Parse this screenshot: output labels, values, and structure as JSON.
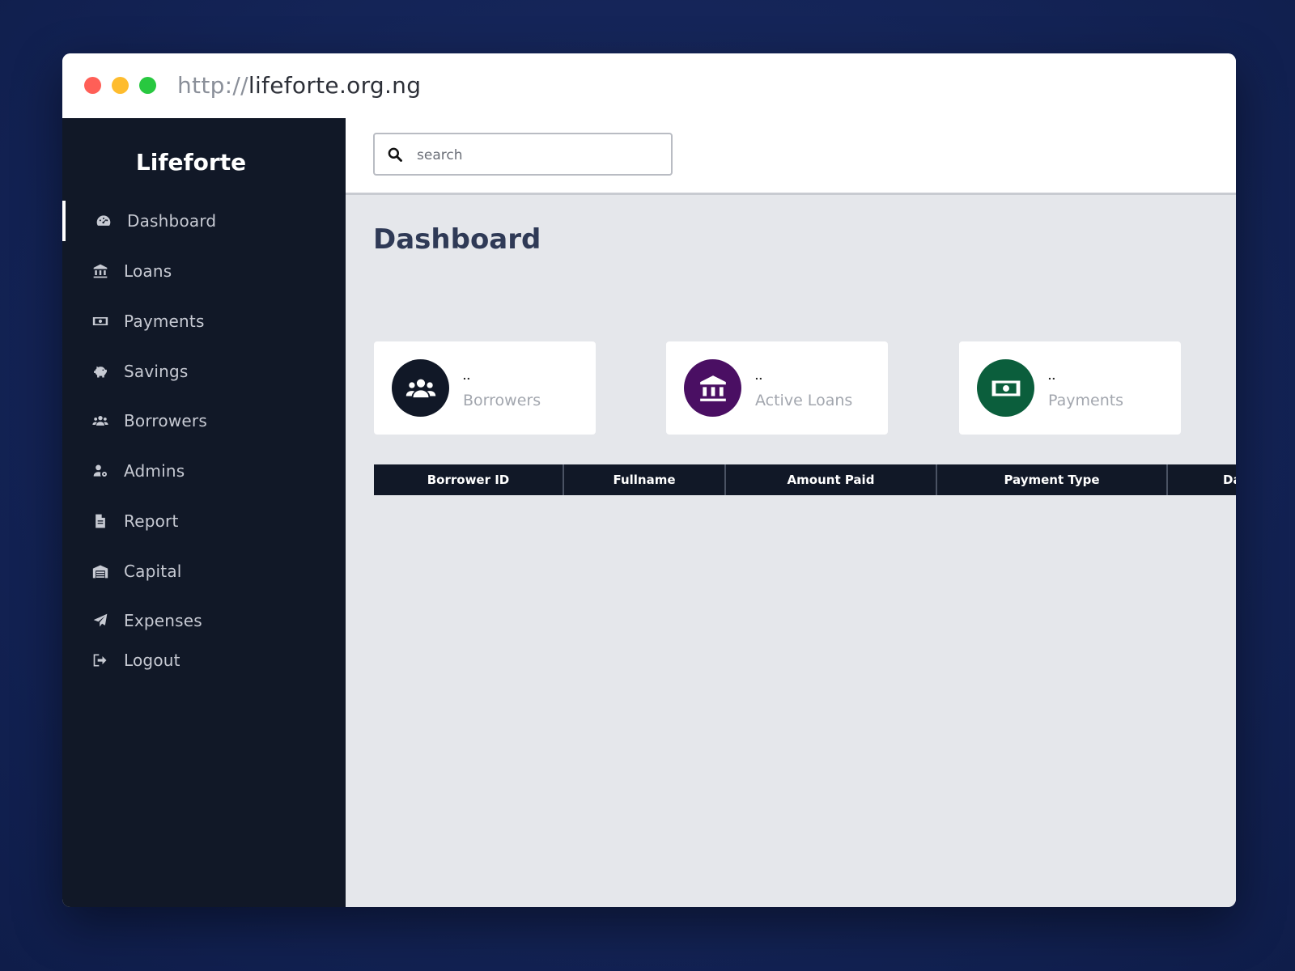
{
  "browser": {
    "url_protocol": "http://",
    "url_host": "lifeforte.org.ng"
  },
  "sidebar": {
    "brand": "Lifeforte",
    "items": [
      {
        "label": "Dashboard",
        "icon": "dashboard-gauge-icon",
        "active": true
      },
      {
        "label": "Loans",
        "icon": "bank-icon"
      },
      {
        "label": "Payments",
        "icon": "money-bill-icon"
      },
      {
        "label": "Savings",
        "icon": "piggy-bank-icon"
      },
      {
        "label": "Borrowers",
        "icon": "users-icon"
      },
      {
        "label": "Admins",
        "icon": "user-cog-icon"
      },
      {
        "label": "Report",
        "icon": "file-icon"
      },
      {
        "label": "Capital",
        "icon": "warehouse-icon"
      },
      {
        "label": "Expenses",
        "icon": "paper-plane-icon"
      },
      {
        "label": "Logout",
        "icon": "sign-out-icon"
      }
    ]
  },
  "search": {
    "placeholder": "search",
    "icon": "search-icon"
  },
  "main": {
    "title": "Dashboard"
  },
  "cards": [
    {
      "value": "..",
      "label": "Borrowers",
      "icon": "users-icon",
      "color": "#111827"
    },
    {
      "value": "..",
      "label": "Active Loans",
      "icon": "bank-icon",
      "color": "#4a0f63"
    },
    {
      "value": "..",
      "label": "Payments",
      "icon": "money-bill-icon",
      "color": "#0b5e3c"
    }
  ],
  "table": {
    "columns": [
      "Borrower ID",
      "Fullname",
      "Amount Paid",
      "Payment Type",
      "Da"
    ]
  },
  "colors": {
    "sidebar_bg": "#111827",
    "main_bg": "#e5e7eb",
    "title_color": "#2f3a56"
  }
}
